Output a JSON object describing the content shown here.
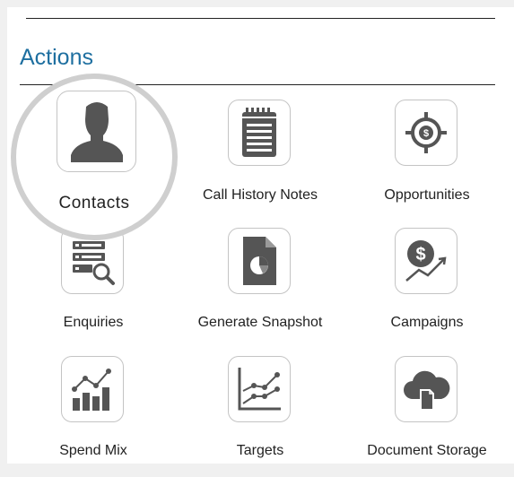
{
  "section": {
    "title": "Actions"
  },
  "tiles": [
    {
      "id": "contacts",
      "label": "Contacts",
      "icon": "person-silhouette-icon",
      "highlighted": true
    },
    {
      "id": "call-history-notes",
      "label": "Call History Notes",
      "icon": "notepad-icon"
    },
    {
      "id": "opportunities",
      "label": "Opportunities",
      "icon": "dollar-target-icon"
    },
    {
      "id": "enquiries",
      "label": "Enquiries",
      "icon": "list-search-icon"
    },
    {
      "id": "generate-snapshot",
      "label": "Generate Snapshot",
      "icon": "pie-document-icon"
    },
    {
      "id": "campaigns",
      "label": "Campaigns",
      "icon": "dollar-growth-icon"
    },
    {
      "id": "spend-mix",
      "label": "Spend Mix",
      "icon": "bar-trend-icon"
    },
    {
      "id": "targets",
      "label": "Targets",
      "icon": "line-graph-icon"
    },
    {
      "id": "document-storage",
      "label": "Document Storage",
      "icon": "cloud-document-icon"
    }
  ],
  "colors": {
    "title": "#1e6fa0",
    "icon": "#555555",
    "highlight_ring": "#cfcfcf",
    "tile_border": "#c4c4c4"
  }
}
